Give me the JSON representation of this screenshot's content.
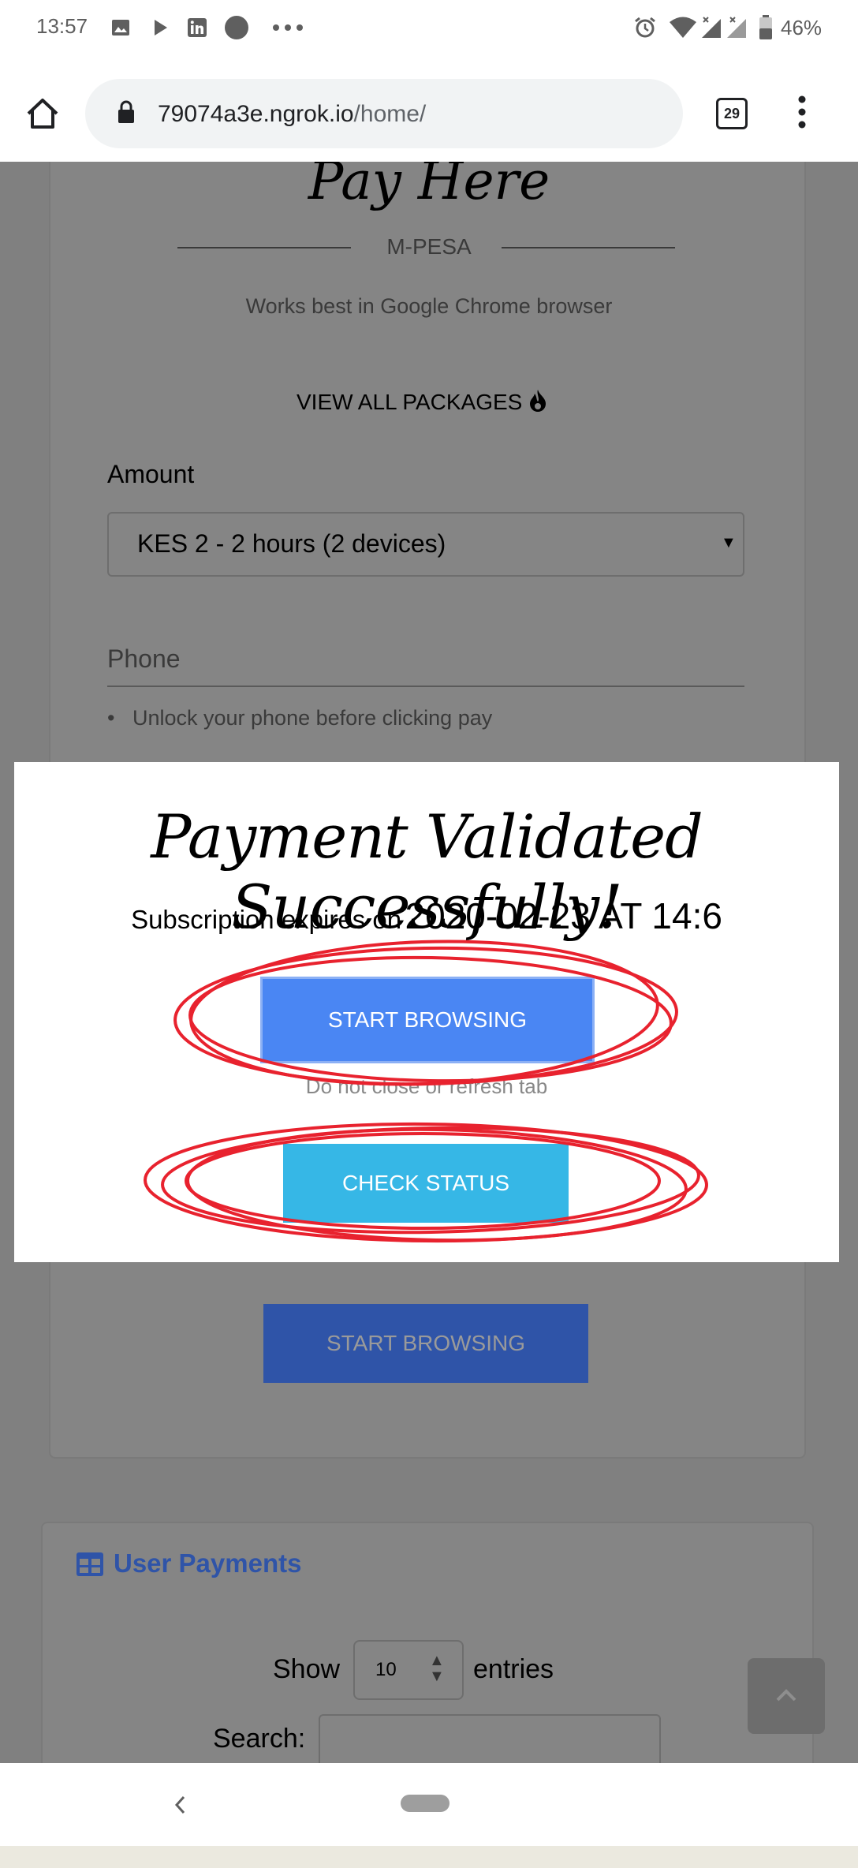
{
  "status_bar": {
    "time": "13:57",
    "battery": "46%",
    "icons": [
      "image-icon",
      "play-icon",
      "linkedin-icon",
      "circle-icon",
      "more-dots-icon",
      "alarm-icon",
      "wifi-icon",
      "signal-icon",
      "battery-icon"
    ]
  },
  "browser": {
    "url_host": "79074a3e.ngrok.io",
    "url_path": "/home/",
    "tab_count": "29"
  },
  "pay_card": {
    "title": "Pay Here",
    "divider_label": "M-PESA",
    "note": "Works best in Google Chrome browser",
    "view_all": "VIEW ALL PACKAGES",
    "amount_label": "Amount",
    "amount_selected": "KES 2 - 2 hours (2 devices)",
    "phone_placeholder": "Phone",
    "hint": "Unlock your phone before clicking pay",
    "start_browsing": "START BROWSING"
  },
  "modal": {
    "title": "Payment Validated Successfully!",
    "expires_prefix": "Subscription expires on",
    "expires_value": "2020-02-23 AT 14:6",
    "start_browsing": "START BROWSING",
    "warning": "Do not close or refresh tab",
    "check_status": "CHECK STATUS"
  },
  "payments_card": {
    "title": "User Payments",
    "show_label": "Show",
    "entries_value": "10",
    "entries_label": "entries",
    "search_label": "Search:"
  },
  "colors": {
    "primary": "#4a86f3",
    "info": "#36b7e6",
    "annotation": "#e8222e",
    "dim_primary": "#2f54a8"
  }
}
